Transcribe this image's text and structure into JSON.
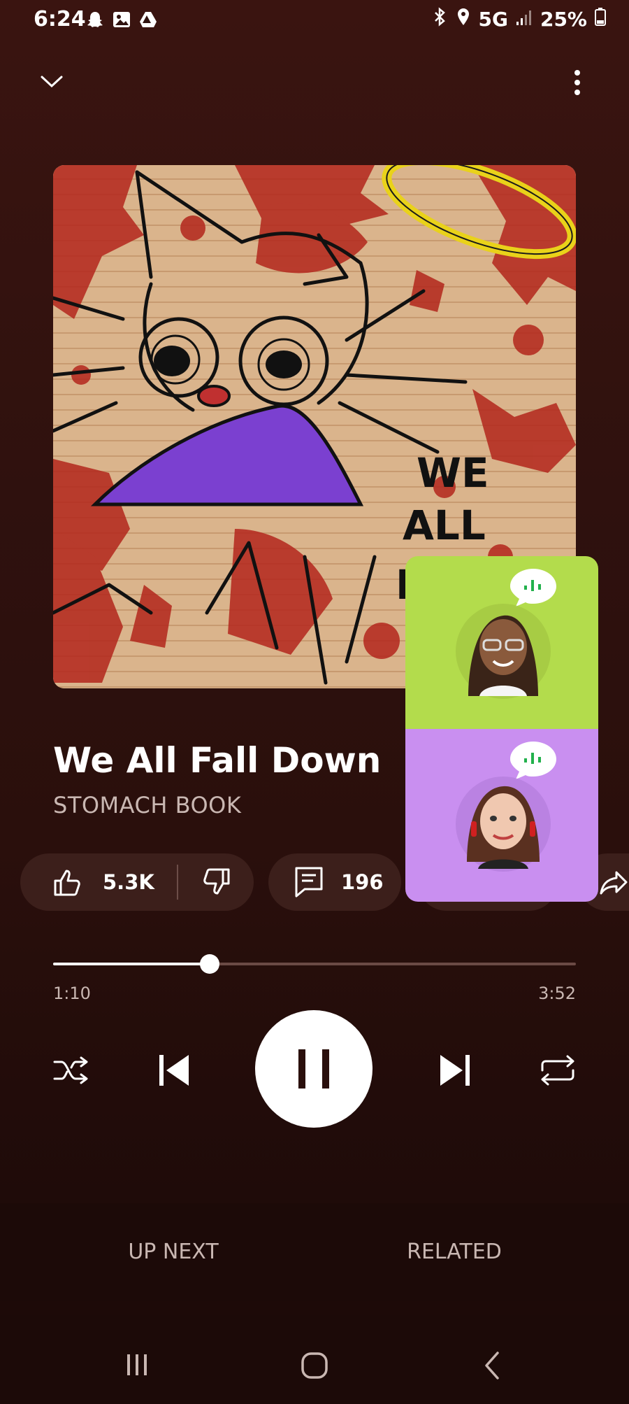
{
  "status_bar": {
    "time": "6:24",
    "network": "5G",
    "battery": "25%"
  },
  "track": {
    "title": "We All Fall Down",
    "artist": "STOMACH BOOK",
    "album_art_text": "WE ALL F"
  },
  "actions": {
    "likes": "5.3K",
    "comments": "196"
  },
  "progress": {
    "elapsed": "1:10",
    "total": "3:52",
    "fraction": 0.3
  },
  "tabs": {
    "up_next": "UP NEXT",
    "related": "RELATED"
  },
  "colors": {
    "background": "#2f110e",
    "pill": "#3c1f1b",
    "call_tile_1": "#b3dc4c",
    "call_tile_2": "#c98ff0",
    "speaking_indicator": "#22b14c"
  },
  "icons": {
    "collapse": "chevron-down-icon",
    "more": "more-vert-icon",
    "like": "thumb-up-icon",
    "dislike": "thumb-down-icon",
    "comment": "comment-icon",
    "share": "share-icon",
    "shuffle": "shuffle-icon",
    "previous": "skip-previous-icon",
    "pause": "pause-icon",
    "next": "skip-next-icon",
    "repeat": "repeat-icon"
  }
}
